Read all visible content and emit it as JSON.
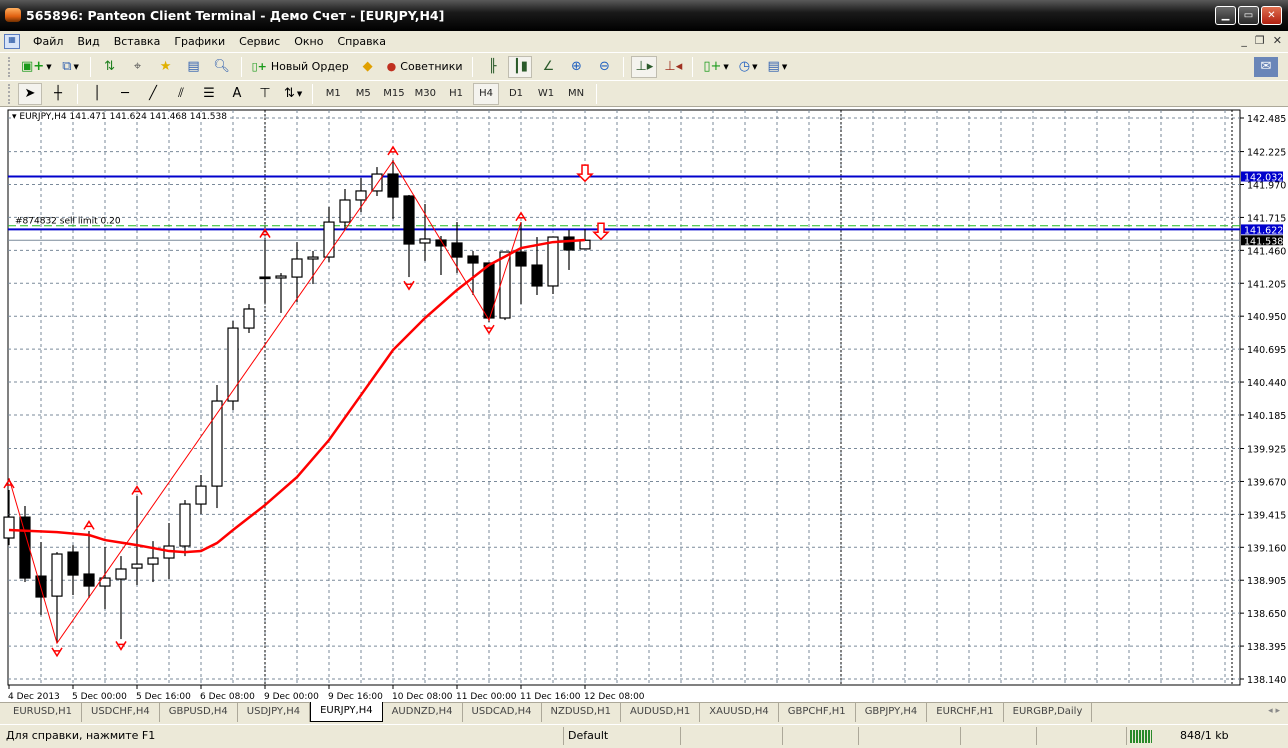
{
  "window": {
    "title": "565896: Panteon Client Terminal - Демо Счет - [EURJPY,H4]"
  },
  "menu": [
    "Файл",
    "Вид",
    "Вставка",
    "Графики",
    "Сервис",
    "Окно",
    "Справка"
  ],
  "toolbar": {
    "new_order": "Новый Ордер",
    "advisors": "Советники"
  },
  "timeframes": [
    "M1",
    "M5",
    "M15",
    "M30",
    "H1",
    "H4",
    "D1",
    "W1",
    "MN"
  ],
  "active_timeframe": "H4",
  "chart_header": "EURJPY,H4  141.471 141.624 141.468 141.538",
  "order_label": "#874832 sell limit 0.20",
  "tabs": [
    "EURUSD,H1",
    "USDCHF,H4",
    "GBPUSD,H4",
    "USDJPY,H4",
    "EURJPY,H4",
    "AUDNZD,H4",
    "USDCAD,H4",
    "NZDUSD,H1",
    "AUDUSD,H1",
    "XAUUSD,H4",
    "GBPCHF,H1",
    "GBPJPY,H4",
    "EURCHF,H1",
    "EURGBP,Daily"
  ],
  "active_tab": "EURJPY,H4",
  "status": {
    "help": "Для справки, нажмите F1",
    "profile": "Default",
    "traffic": "848/1 kb"
  },
  "colors": {
    "ma": "#ff0000",
    "zigzag": "#ff0000",
    "level": "#0000cc",
    "order": "#0000cc",
    "bid": "#7a8a9a",
    "grid": "#7a8a9a"
  },
  "chart_data": {
    "type": "candlestick",
    "symbol": "EURJPY",
    "timeframe": "H4",
    "ylim": [
      138.14,
      142.485
    ],
    "y_ticks": [
      "142.485",
      "142.225",
      "141.970",
      "141.715",
      "141.460",
      "141.205",
      "140.950",
      "140.695",
      "140.440",
      "140.185",
      "139.925",
      "139.670",
      "139.415",
      "139.160",
      "138.905",
      "138.650",
      "138.395",
      "138.140"
    ],
    "x_labels": [
      {
        "i": 0,
        "label": "4 Dec 2013"
      },
      {
        "i": 4,
        "label": "5 Dec 00:00"
      },
      {
        "i": 8,
        "label": "5 Dec 16:00"
      },
      {
        "i": 12,
        "label": "6 Dec 08:00"
      },
      {
        "i": 16,
        "label": "9 Dec 00:00"
      },
      {
        "i": 20,
        "label": "9 Dec 16:00"
      },
      {
        "i": 24,
        "label": "10 Dec 08:00"
      },
      {
        "i": 28,
        "label": "11 Dec 00:00"
      },
      {
        "i": 32,
        "label": "11 Dec 16:00"
      },
      {
        "i": 36,
        "label": "12 Dec 08:00"
      }
    ],
    "ohlc": [
      [
        139.232,
        139.604,
        139.177,
        139.394
      ],
      [
        139.394,
        139.48,
        138.891,
        138.922
      ],
      [
        138.937,
        139.201,
        138.635,
        138.775
      ],
      [
        138.782,
        139.123,
        138.418,
        139.108
      ],
      [
        139.123,
        139.177,
        138.79,
        138.945
      ],
      [
        138.953,
        139.286,
        138.767,
        138.86
      ],
      [
        138.86,
        139.162,
        138.682,
        138.922
      ],
      [
        138.914,
        139.092,
        138.449,
        138.992
      ],
      [
        138.999,
        139.557,
        138.868,
        139.03
      ],
      [
        139.03,
        139.208,
        138.891,
        139.077
      ],
      [
        139.077,
        139.348,
        138.914,
        139.17
      ],
      [
        139.17,
        139.526,
        139.092,
        139.495
      ],
      [
        139.495,
        139.72,
        139.418,
        139.634
      ],
      [
        139.634,
        140.417,
        139.464,
        140.293
      ],
      [
        140.293,
        140.913,
        140.223,
        140.858
      ],
      [
        140.858,
        141.044,
        140.82,
        141.006
      ],
      [
        141.253,
        141.54,
        141.052,
        141.246
      ],
      [
        141.246,
        141.284,
        140.975,
        141.261
      ],
      [
        141.253,
        141.524,
        141.06,
        141.393
      ],
      [
        141.393,
        141.455,
        141.199,
        141.408
      ],
      [
        141.408,
        141.796,
        141.37,
        141.679
      ],
      [
        141.679,
        141.935,
        141.617,
        141.85
      ],
      [
        141.85,
        142.02,
        141.757,
        141.92
      ],
      [
        141.92,
        142.105,
        141.881,
        142.051
      ],
      [
        142.051,
        142.16,
        141.703,
        141.873
      ],
      [
        141.881,
        141.889,
        141.253,
        141.509
      ],
      [
        141.517,
        141.819,
        141.377,
        141.548
      ],
      [
        141.54,
        141.571,
        141.269,
        141.494
      ],
      [
        141.517,
        141.679,
        141.284,
        141.408
      ],
      [
        141.416,
        141.455,
        141.114,
        141.362
      ],
      [
        141.362,
        141.362,
        140.905,
        140.936
      ],
      [
        140.936,
        141.447,
        140.92,
        141.447
      ],
      [
        141.447,
        141.679,
        141.044,
        141.339
      ],
      [
        141.346,
        141.563,
        141.114,
        141.184
      ],
      [
        141.184,
        141.563,
        141.122,
        141.563
      ],
      [
        141.563,
        141.617,
        141.308,
        141.463
      ],
      [
        141.471,
        141.624,
        141.468,
        141.538
      ]
    ],
    "moving_average": [
      [
        0,
        139.294
      ],
      [
        3,
        139.278
      ],
      [
        5,
        139.255
      ],
      [
        6,
        139.216
      ],
      [
        8,
        139.177
      ],
      [
        9,
        139.154
      ],
      [
        10,
        139.131
      ],
      [
        11,
        139.123
      ],
      [
        12,
        139.131
      ],
      [
        13,
        139.193
      ],
      [
        14,
        139.294
      ],
      [
        16,
        139.487
      ],
      [
        18,
        139.704
      ],
      [
        20,
        139.991
      ],
      [
        22,
        140.339
      ],
      [
        24,
        140.688
      ],
      [
        26,
        140.936
      ],
      [
        28,
        141.153
      ],
      [
        30,
        141.346
      ],
      [
        32,
        141.478
      ],
      [
        34,
        141.524
      ],
      [
        36,
        141.54
      ]
    ],
    "zigzag": [
      [
        0,
        139.696
      ],
      [
        3,
        138.418
      ],
      [
        24,
        142.152
      ],
      [
        30,
        140.92
      ],
      [
        32,
        141.679
      ]
    ],
    "fractals_up": [
      [
        0,
        139.65
      ],
      [
        5,
        139.33
      ],
      [
        8,
        139.6
      ],
      [
        16,
        141.59
      ],
      [
        24,
        142.23
      ],
      [
        32,
        141.72
      ]
    ],
    "fractals_down": [
      [
        3,
        138.35
      ],
      [
        7,
        138.4
      ],
      [
        25,
        141.19
      ],
      [
        30,
        140.85
      ]
    ],
    "signal_arrows": [
      [
        36,
        142.05
      ],
      [
        37,
        141.6
      ]
    ],
    "levels": [
      {
        "price": 142.032,
        "label": "142.032",
        "kind": "level"
      },
      {
        "price": 141.622,
        "label": "141.622",
        "kind": "order"
      }
    ],
    "tp_line": 141.65,
    "bid": {
      "price": 141.538,
      "label": "141.538"
    }
  }
}
